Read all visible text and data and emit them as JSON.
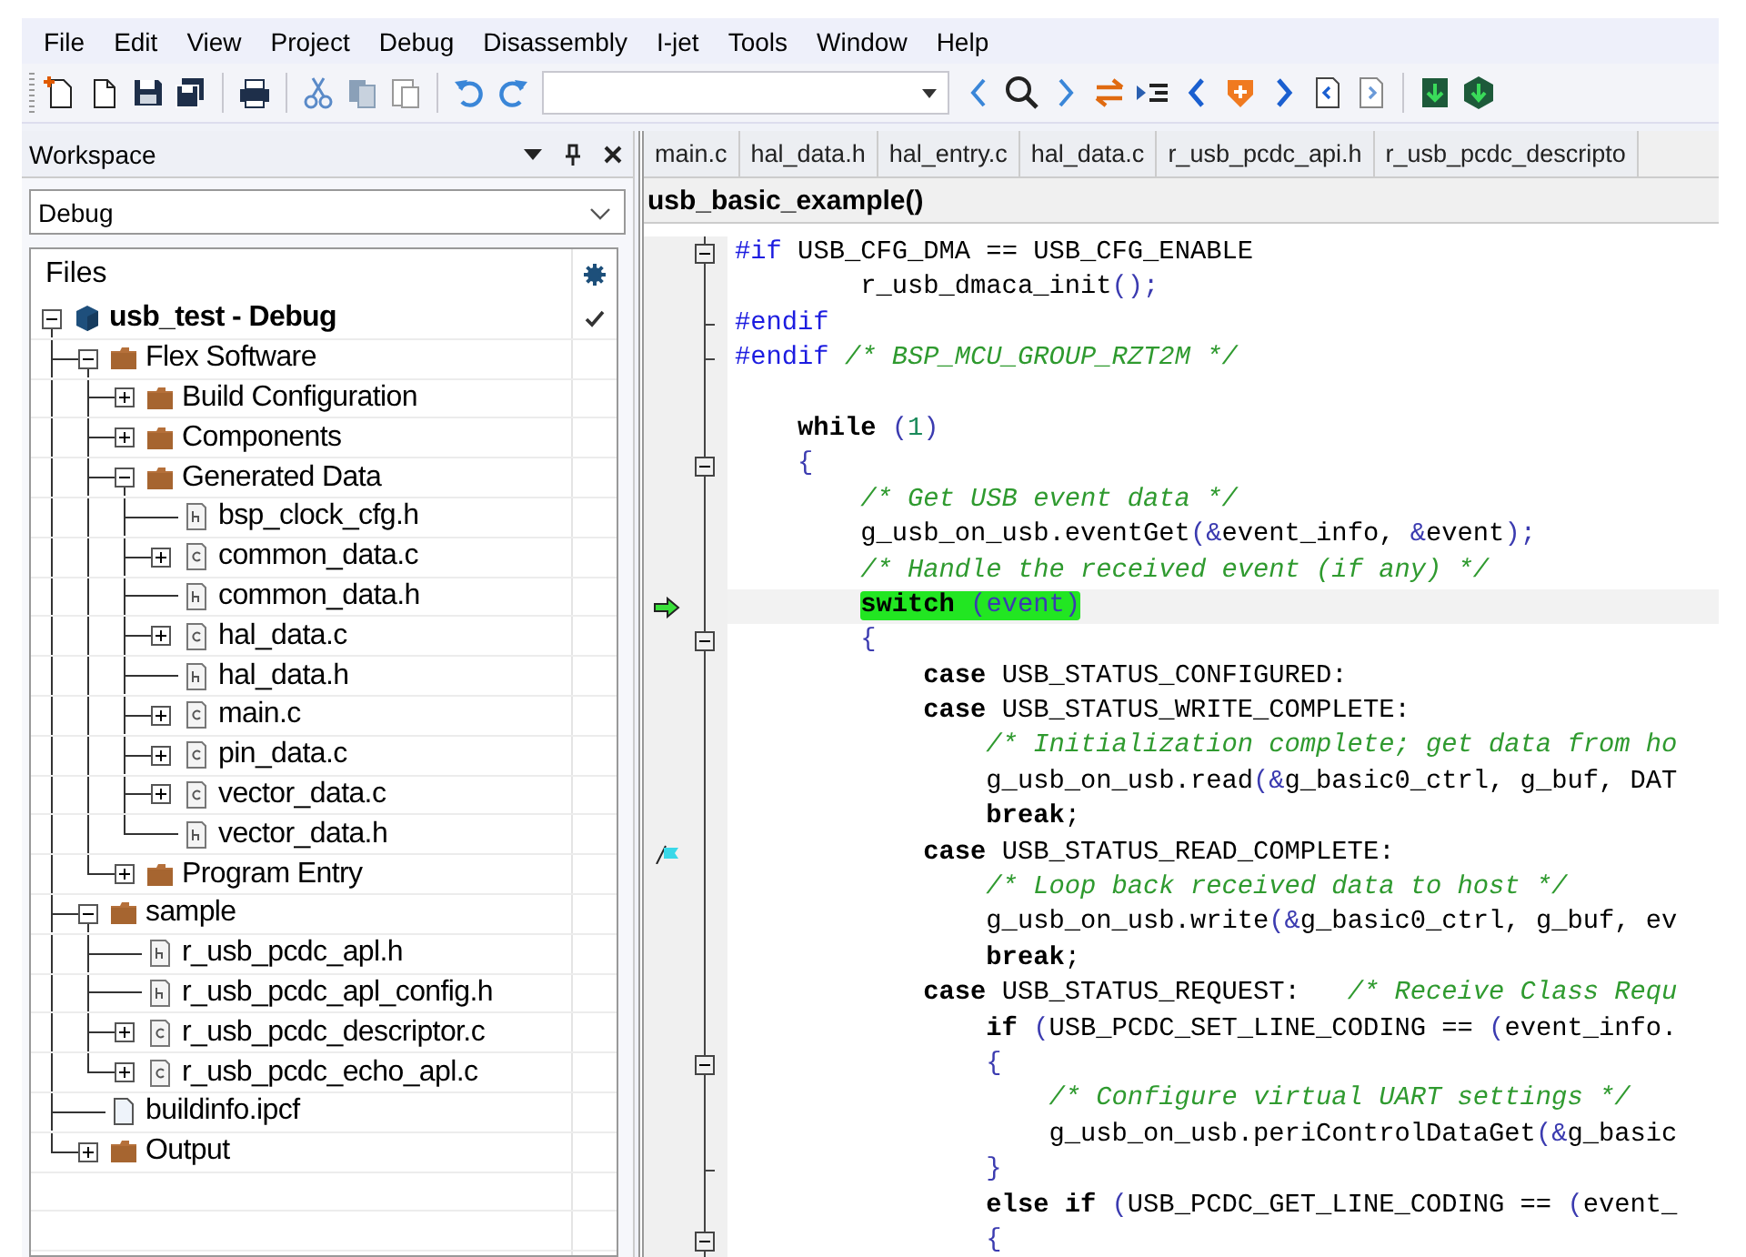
{
  "menu": [
    "File",
    "Edit",
    "View",
    "Project",
    "Debug",
    "Disassembly",
    "I-jet",
    "Tools",
    "Window",
    "Help"
  ],
  "workspace": {
    "title": "Workspace",
    "configuration": "Debug",
    "files_header": "Files",
    "tree": [
      {
        "label": "usb_test - Debug",
        "kind": "project",
        "expanded": true,
        "active": true,
        "children": [
          {
            "label": "Flex Software",
            "kind": "folder",
            "expanded": true,
            "active": false,
            "children": [
              {
                "label": "Build Configuration",
                "kind": "folder",
                "expanded": false,
                "active": false
              },
              {
                "label": "Components",
                "kind": "folder",
                "expanded": false,
                "active": false
              },
              {
                "label": "Generated Data",
                "kind": "folder",
                "expanded": true,
                "active": false,
                "children": [
                  {
                    "label": "bsp_clock_cfg.h",
                    "kind": "header",
                    "active": false
                  },
                  {
                    "label": "common_data.c",
                    "kind": "source",
                    "expanded": false,
                    "active": false
                  },
                  {
                    "label": "common_data.h",
                    "kind": "header",
                    "active": false
                  },
                  {
                    "label": "hal_data.c",
                    "kind": "source",
                    "expanded": false,
                    "active": false
                  },
                  {
                    "label": "hal_data.h",
                    "kind": "header",
                    "active": false
                  },
                  {
                    "label": "main.c",
                    "kind": "source",
                    "expanded": false,
                    "active": false
                  },
                  {
                    "label": "pin_data.c",
                    "kind": "source",
                    "expanded": false,
                    "active": false
                  },
                  {
                    "label": "vector_data.c",
                    "kind": "source",
                    "expanded": false,
                    "active": false
                  },
                  {
                    "label": "vector_data.h",
                    "kind": "header",
                    "active": false
                  }
                ]
              },
              {
                "label": "Program Entry",
                "kind": "folder",
                "expanded": false,
                "active": false
              }
            ]
          },
          {
            "label": "sample",
            "kind": "folder",
            "expanded": true,
            "active": false,
            "children": [
              {
                "label": "r_usb_pcdc_apl.h",
                "kind": "header",
                "active": false
              },
              {
                "label": "r_usb_pcdc_apl_config.h",
                "kind": "header",
                "active": false
              },
              {
                "label": "r_usb_pcdc_descriptor.c",
                "kind": "source",
                "expanded": false,
                "active": false
              },
              {
                "label": "r_usb_pcdc_echo_apl.c",
                "kind": "source",
                "expanded": false,
                "active": false
              }
            ]
          },
          {
            "label": "buildinfo.ipcf",
            "kind": "document",
            "active": false
          },
          {
            "label": "Output",
            "kind": "folder",
            "expanded": false,
            "active": false
          }
        ]
      }
    ]
  },
  "editor": {
    "tabs": [
      {
        "label": "main.c",
        "selected": false
      },
      {
        "label": "hal_data.h",
        "selected": false
      },
      {
        "label": "hal_entry.c",
        "selected": false
      },
      {
        "label": "hal_data.c",
        "selected": false
      },
      {
        "label": "r_usb_pcdc_api.h",
        "selected": false
      },
      {
        "label": "r_usb_pcdc_descripto",
        "selected": false
      }
    ],
    "function": "usb_basic_example()",
    "lines": [
      {
        "kind": "fold",
        "current": false,
        "bookmarked": false,
        "tokens": [
          {
            "kind": "pp",
            "text": "#if"
          },
          {
            "kind": "tx",
            "text": " USB_CFG_DMA == USB_CFG_ENABLE"
          }
        ]
      },
      {
        "kind": "code",
        "current": false,
        "bookmarked": false,
        "tokens": [
          {
            "kind": "tx",
            "text": "        r_usb_dmaca_init"
          },
          {
            "kind": "pn",
            "text": "();"
          }
        ]
      },
      {
        "kind": "fold-end",
        "current": false,
        "bookmarked": false,
        "tokens": [
          {
            "kind": "pp",
            "text": "#endif"
          }
        ]
      },
      {
        "kind": "fold-end",
        "current": false,
        "bookmarked": false,
        "tokens": [
          {
            "kind": "pp",
            "text": "#endif"
          },
          {
            "kind": "cm",
            "text": " /* BSP_MCU_GROUP_RZT2M */"
          }
        ]
      },
      {
        "kind": "blank",
        "current": false,
        "bookmarked": false
      },
      {
        "kind": "code",
        "current": false,
        "bookmarked": false,
        "tokens": [
          {
            "kind": "kw",
            "text": "    while "
          },
          {
            "kind": "pn",
            "text": "("
          },
          {
            "kind": "num",
            "text": "1"
          },
          {
            "kind": "pn",
            "text": ")"
          }
        ]
      },
      {
        "kind": "fold",
        "current": false,
        "bookmarked": false,
        "tokens": [
          {
            "kind": "pn",
            "text": "    {"
          }
        ]
      },
      {
        "kind": "code",
        "current": false,
        "bookmarked": false,
        "tokens": [
          {
            "kind": "cm",
            "text": "        /* Get USB event data */"
          }
        ]
      },
      {
        "kind": "code",
        "current": false,
        "bookmarked": false,
        "tokens": [
          {
            "kind": "tx",
            "text": "        g_usb_on_usb.eventGet"
          },
          {
            "kind": "pn",
            "text": "(&"
          },
          {
            "kind": "tx",
            "text": "event_info, "
          },
          {
            "kind": "pn",
            "text": "&"
          },
          {
            "kind": "tx",
            "text": "event"
          },
          {
            "kind": "pn",
            "text": ");"
          }
        ]
      },
      {
        "kind": "code",
        "current": false,
        "bookmarked": false,
        "tokens": [
          {
            "kind": "cm",
            "text": "        /* Handle the received event (if any) */"
          }
        ]
      },
      {
        "kind": "code",
        "current": true,
        "bookmarked": false,
        "tokens": [
          {
            "kind": "exec",
            "parts": [
              {
                "kind": "kw",
                "text": "        switch"
              },
              {
                "kind": "pn",
                "text": " (event)"
              }
            ]
          }
        ]
      },
      {
        "kind": "fold",
        "current": false,
        "bookmarked": false,
        "tokens": [
          {
            "kind": "pn",
            "text": "        {"
          }
        ]
      },
      {
        "kind": "code",
        "current": false,
        "bookmarked": false,
        "tokens": [
          {
            "kind": "kw",
            "text": "            case"
          },
          {
            "kind": "tx",
            "text": " USB_STATUS_CONFIGURED:"
          }
        ]
      },
      {
        "kind": "code",
        "current": false,
        "bookmarked": false,
        "tokens": [
          {
            "kind": "kw",
            "text": "            case"
          },
          {
            "kind": "tx",
            "text": " USB_STATUS_WRITE_COMPLETE:"
          }
        ]
      },
      {
        "kind": "code",
        "current": false,
        "bookmarked": false,
        "tokens": [
          {
            "kind": "cm",
            "text": "                /* Initialization complete; get data from ho"
          }
        ]
      },
      {
        "kind": "code",
        "current": false,
        "bookmarked": false,
        "tokens": [
          {
            "kind": "tx",
            "text": "                g_usb_on_usb.read"
          },
          {
            "kind": "pn",
            "text": "(&"
          },
          {
            "kind": "tx",
            "text": "g_basic0_ctrl, g_buf, DAT"
          }
        ]
      },
      {
        "kind": "code",
        "current": false,
        "bookmarked": false,
        "tokens": [
          {
            "kind": "kw",
            "text": "                break"
          },
          {
            "kind": "tx",
            "text": ";"
          }
        ]
      },
      {
        "kind": "code",
        "current": false,
        "bookmarked": true,
        "tokens": [
          {
            "kind": "kw",
            "text": "            case"
          },
          {
            "kind": "tx",
            "text": " USB_STATUS_READ_COMPLETE:"
          }
        ]
      },
      {
        "kind": "code",
        "current": false,
        "bookmarked": false,
        "tokens": [
          {
            "kind": "cm",
            "text": "                /* Loop back received data to host */"
          }
        ]
      },
      {
        "kind": "code",
        "current": false,
        "bookmarked": false,
        "tokens": [
          {
            "kind": "tx",
            "text": "                g_usb_on_usb.write"
          },
          {
            "kind": "pn",
            "text": "(&"
          },
          {
            "kind": "tx",
            "text": "g_basic0_ctrl, g_buf, ev"
          }
        ]
      },
      {
        "kind": "code",
        "current": false,
        "bookmarked": false,
        "tokens": [
          {
            "kind": "kw",
            "text": "                break"
          },
          {
            "kind": "tx",
            "text": ";"
          }
        ]
      },
      {
        "kind": "code",
        "current": false,
        "bookmarked": false,
        "tokens": [
          {
            "kind": "kw",
            "text": "            case"
          },
          {
            "kind": "tx",
            "text": " USB_STATUS_REQUEST:   "
          },
          {
            "kind": "cm",
            "text": "/* Receive Class Requ"
          }
        ]
      },
      {
        "kind": "code",
        "current": false,
        "bookmarked": false,
        "tokens": [
          {
            "kind": "kw",
            "text": "                if "
          },
          {
            "kind": "pn",
            "text": "("
          },
          {
            "kind": "tx",
            "text": "USB_PCDC_SET_LINE_CODING == "
          },
          {
            "kind": "pn",
            "text": "("
          },
          {
            "kind": "tx",
            "text": "event_info."
          }
        ]
      },
      {
        "kind": "fold",
        "current": false,
        "bookmarked": false,
        "tokens": [
          {
            "kind": "pn",
            "text": "                {"
          }
        ]
      },
      {
        "kind": "code",
        "current": false,
        "bookmarked": false,
        "tokens": [
          {
            "kind": "cm",
            "text": "                    /* Configure virtual UART settings */"
          }
        ]
      },
      {
        "kind": "code",
        "current": false,
        "bookmarked": false,
        "tokens": [
          {
            "kind": "tx",
            "text": "                    g_usb_on_usb.periControlDataGet"
          },
          {
            "kind": "pn",
            "text": "(&"
          },
          {
            "kind": "tx",
            "text": "g_basic"
          }
        ]
      },
      {
        "kind": "fold-end",
        "current": false,
        "bookmarked": false,
        "tokens": [
          {
            "kind": "pn",
            "text": "                }"
          }
        ]
      },
      {
        "kind": "code",
        "current": false,
        "bookmarked": false,
        "tokens": [
          {
            "kind": "kw",
            "text": "                else if "
          },
          {
            "kind": "pn",
            "text": "("
          },
          {
            "kind": "tx",
            "text": "USB_PCDC_GET_LINE_CODING == "
          },
          {
            "kind": "pn",
            "text": "("
          },
          {
            "kind": "tx",
            "text": "event_"
          }
        ]
      },
      {
        "kind": "fold",
        "current": false,
        "bookmarked": false,
        "tokens": [
          {
            "kind": "pn",
            "text": "                {"
          }
        ]
      }
    ]
  }
}
